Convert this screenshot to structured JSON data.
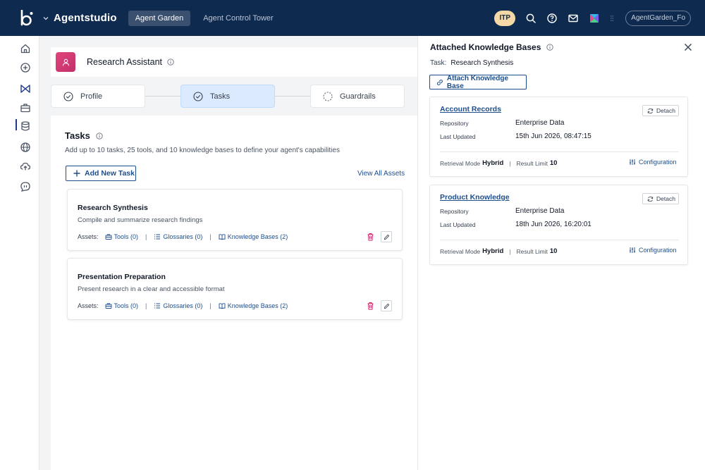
{
  "topbar": {
    "brand": "Agentstudio",
    "tabs": [
      {
        "label": "Agent Garden",
        "active": true
      },
      {
        "label": "Agent Control Tower",
        "active": false
      }
    ],
    "badge": "ITP",
    "user": "AgentGarden_Fo",
    "icons": [
      "search-icon",
      "help-icon",
      "mail-icon",
      "apps-logo-icon",
      "grid-icon"
    ]
  },
  "sidebar": {
    "items": [
      "home-icon",
      "add-circle-icon",
      "agents-icon",
      "briefcase-icon",
      "database-icon",
      "globe-icon",
      "cloud-upload-icon",
      "chat-icon"
    ],
    "active": "agents-icon"
  },
  "agent": {
    "name": "Research Assistant"
  },
  "stepper": {
    "steps": [
      {
        "label": "Profile",
        "state": "done"
      },
      {
        "label": "Tasks",
        "state": "active"
      },
      {
        "label": "Guardrails",
        "state": "pending"
      }
    ]
  },
  "tasks_section": {
    "title": "Tasks",
    "subtitle": "Add up to 10 tasks, 25 tools, and 10 knowledge bases to define your agent's capabilities",
    "add_button": "Add New Task",
    "view_all": "View All Assets",
    "assets_label": "Assets:",
    "tasks": [
      {
        "name": "Research Synthesis",
        "description": "Compile and summarize research findings",
        "tools": "Tools (0)",
        "glossaries": "Glossaries (0)",
        "knowledge_bases": "Knowledge Bases (2)"
      },
      {
        "name": "Presentation Preparation",
        "description": "Present research in a clear and accessible format",
        "tools": "Tools (0)",
        "glossaries": "Glossaries (0)",
        "knowledge_bases": "Knowledge Bases (2)"
      }
    ]
  },
  "panel": {
    "title": "Attached Knowledge Bases",
    "task_label": "Task:",
    "task_value": "Research Synthesis",
    "attach_button": "Attach Knowledge Base",
    "repository_label": "Repository",
    "last_updated_label": "Last Updated",
    "retrieval_label": "Retrieval Mode",
    "result_limit_label": "Result Limit",
    "detach_label": "Detach",
    "config_label": "Configuration",
    "knowledge_bases": [
      {
        "name": "Account Records",
        "repository": "Enterprise Data",
        "last_updated": "15th Jun 2026, 08:47:15",
        "retrieval_mode": "Hybrid",
        "result_limit": "10"
      },
      {
        "name": "Product Knowledge",
        "repository": "Enterprise Data",
        "last_updated": "18th Jun 2026, 16:20:01",
        "retrieval_mode": "Hybrid",
        "result_limit": "10"
      }
    ]
  }
}
